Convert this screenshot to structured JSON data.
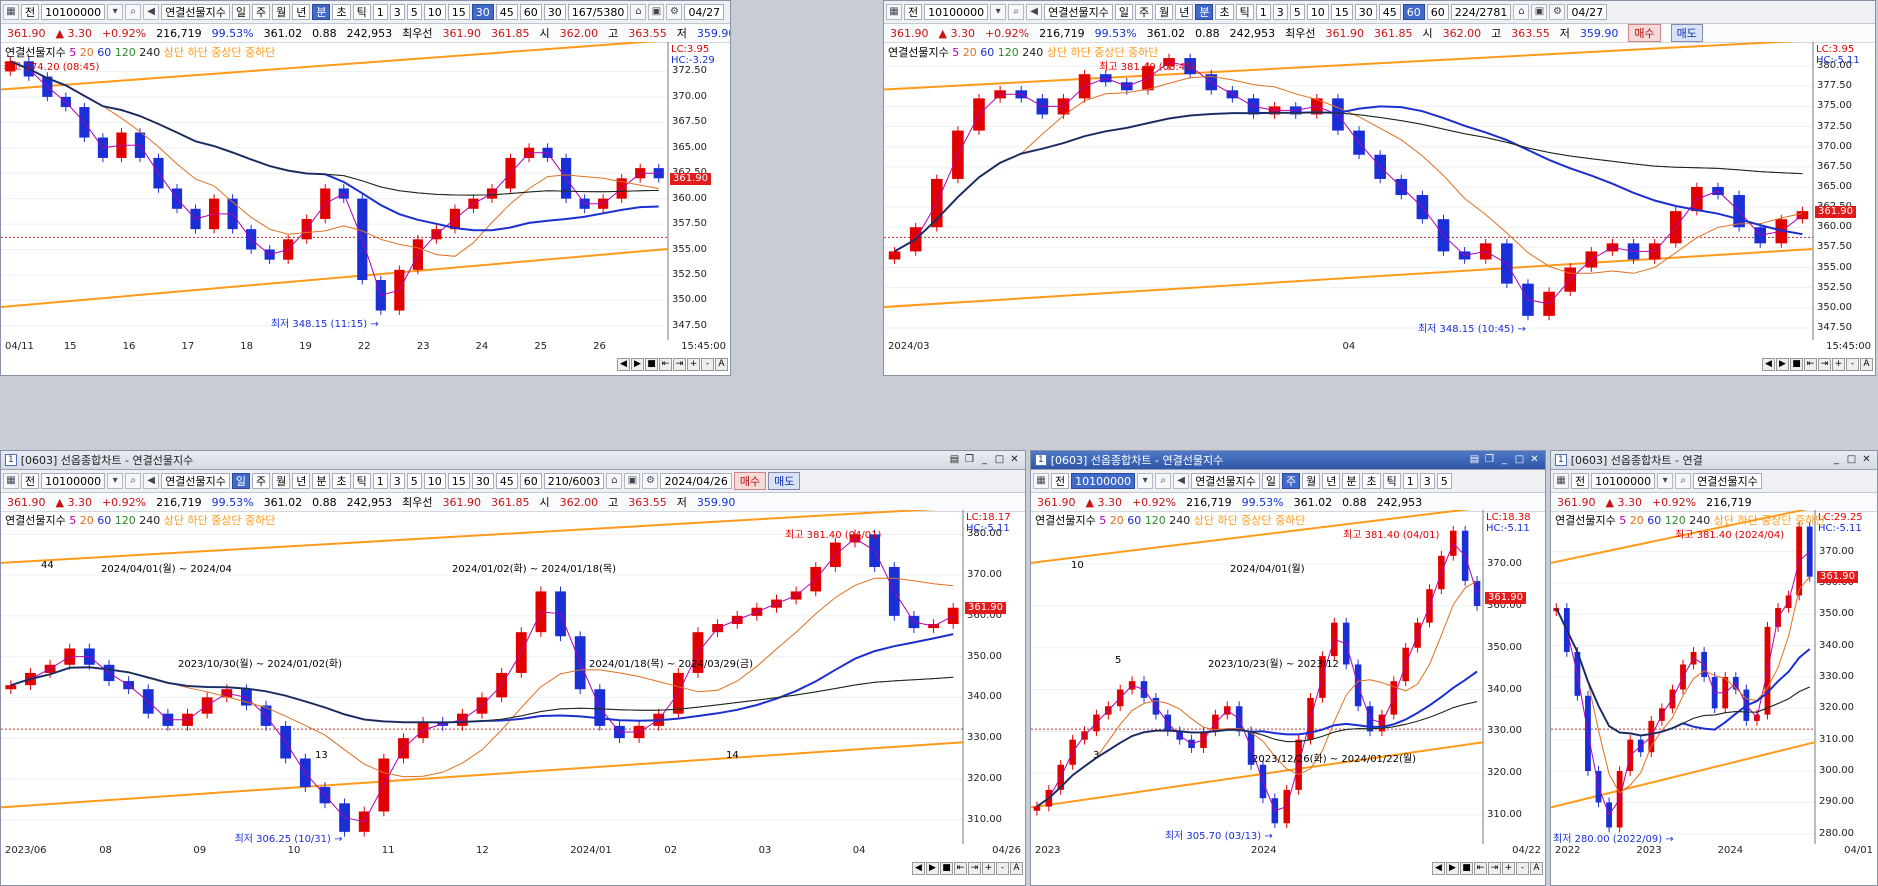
{
  "common": {
    "code": "10100000",
    "index_name": "연결선물지수",
    "periods": [
      "일",
      "주",
      "월",
      "년",
      "분",
      "초",
      "틱"
    ],
    "minutes": [
      "1",
      "3",
      "5",
      "10",
      "15",
      "30",
      "45",
      "60"
    ],
    "quote": {
      "price": "361.90",
      "arrow": "▲",
      "change": "3.30",
      "pct": "+0.92%",
      "volume": "216,719",
      "ratio": "99.53%",
      "v1": "361.02",
      "v2": "0.88",
      "oi": "242,953",
      "best_label": "최우선",
      "bid": "361.90",
      "ask": "361.85",
      "open_label": "시",
      "open": "362.00",
      "high_label": "고",
      "high": "363.55",
      "low_label": "저",
      "low": "359.90"
    },
    "buy_label": "매수",
    "sell_label": "매도",
    "legend_name": "연결선물지수",
    "ma": [
      "5",
      "20",
      "60",
      "120",
      "240"
    ],
    "bands": "상단 하단 중상단 중하단",
    "colors": {
      "up": "#e00000",
      "down": "#1a2fd6",
      "ma5": "#b000b0",
      "ma20": "#e07020",
      "ma60": "#1b2fd0",
      "ma120": "#2a8a2a",
      "ma240": "#222222",
      "channel": "#ff9a1a",
      "trend": "#7fb0ec"
    }
  },
  "panels": [
    {
      "sel_period": "분",
      "sel_minute": "30",
      "period_input": "30",
      "count": "167/5380",
      "date": "04/27",
      "lc": "LC:3.95",
      "hc": "HC:-3.29",
      "tag": "361.90",
      "yaxis": [
        "372.50",
        "370.00",
        "367.50",
        "365.00",
        "362.50",
        "360.00",
        "357.50",
        "355.00",
        "352.50",
        "350.00",
        "347.50"
      ],
      "xaxis": [
        "04/11",
        "15",
        "16",
        "17",
        "18",
        "19",
        "22",
        "23",
        "24",
        "25",
        "26",
        "15:45:00"
      ],
      "high_ann": "최고 374.20 (08:45)",
      "low_ann": "최저 348.15 (11:15)",
      "chart_data": {
        "type": "line",
        "title": "연결선물지수",
        "x_unit": "30min",
        "ylim": [
          346.5,
          375
        ],
        "series": [
          {
            "name": "연결선물지수",
            "values": [
              373.5,
              372,
              370,
              369,
              366,
              364,
              366.5,
              364,
              361,
              359,
              357,
              360,
              357,
              355,
              354,
              356,
              358,
              361,
              360,
              352,
              349,
              353,
              356,
              357,
              359,
              360,
              361,
              364,
              365,
              364,
              360,
              359,
              360,
              362,
              363,
              362
            ]
          }
        ]
      }
    },
    {
      "sel_period": "분",
      "sel_minute": "60",
      "period_input": "60",
      "count": "224/2781",
      "date": "04/27",
      "lc": "LC:3.95",
      "hc": "HC:-5.11",
      "tag": "361.90",
      "yaxis": [
        "380.00",
        "377.50",
        "375.00",
        "372.50",
        "370.00",
        "367.50",
        "365.00",
        "362.50",
        "360.00",
        "357.50",
        "355.00",
        "352.50",
        "350.00",
        "347.50"
      ],
      "xaxis": [
        "2024/03",
        "04",
        "15:45:00"
      ],
      "high_ann": "최고 381.40 (08:45)",
      "low_ann": "최저 348.15 (10:45)",
      "chart_data": {
        "type": "line",
        "title": "연결선물지수",
        "x_unit": "60min",
        "ylim": [
          346.5,
          382.5
        ],
        "series": [
          {
            "name": "연결선물지수",
            "values": [
              357,
              360,
              366,
              372,
              376,
              377,
              376,
              374,
              376,
              379,
              378,
              377,
              380,
              381,
              379,
              377,
              376,
              374,
              375,
              374,
              376,
              372,
              369,
              366,
              364,
              361,
              357,
              356,
              358,
              353,
              349,
              352,
              355,
              357,
              358,
              356,
              358,
              362,
              365,
              364,
              360,
              358,
              361,
              362
            ]
          }
        ]
      }
    },
    {
      "title": "[0603] 선옵종합차트 - 연결선물지수",
      "titlenum": "1",
      "sel_period": "일",
      "count": "210/6003",
      "date": "2024/04/26",
      "lc": "LC:18.17",
      "hc": "HC:-5.11",
      "tag": "361.90",
      "yaxis": [
        "380.00",
        "370.00",
        "360.00",
        "350.00",
        "340.00",
        "330.00",
        "320.00",
        "310.00"
      ],
      "xaxis": [
        "2023/06",
        "08",
        "09",
        "10",
        "11",
        "12",
        "2024/01",
        "02",
        "03",
        "04",
        "04/26"
      ],
      "anns": [
        "44",
        "2023/10/30(월) ~ 2024/01/02(화)",
        "13",
        "2024/01/02(화) ~ 2024/01/18(목)",
        "2024/01/18(목) ~ 2024/03/29(금)",
        "14",
        "2024/04/01(월) ~ 2024/04"
      ],
      "high_ann": "최고 381.40 (04/01)",
      "low_ann": "최저 306.25 (10/31)",
      "chart_data": {
        "type": "line",
        "title": "연결선물지수",
        "x_unit": "day",
        "ylim": [
          305,
          385
        ],
        "series": [
          {
            "name": "연결선물지수",
            "values": [
              343,
              346,
              348,
              352,
              348,
              344,
              342,
              336,
              333,
              336,
              340,
              342,
              338,
              333,
              325,
              318,
              314,
              307,
              312,
              325,
              330,
              334,
              333,
              336,
              340,
              346,
              356,
              366,
              355,
              342,
              333,
              330,
              333,
              336,
              346,
              356,
              358,
              360,
              362,
              364,
              366,
              372,
              378,
              380,
              372,
              360,
              357,
              358,
              362
            ]
          }
        ]
      }
    },
    {
      "title": "[0603] 선옵종합차트 - 연결선물지수",
      "titlenum": "1",
      "sel_period": "주",
      "date": "04/22",
      "lc": "LC:18.38",
      "hc": "HC:-5.11",
      "tag": "361.90",
      "yaxis": [
        "370.00",
        "360.00",
        "350.00",
        "340.00",
        "330.00",
        "320.00",
        "310.00"
      ],
      "xaxis": [
        "2023",
        "2024",
        "04/22"
      ],
      "anns": [
        "10",
        "2023/10/23(월) ~ 2023/12",
        "3",
        "2024/04/01(월)",
        "5",
        "2023/12/26(화) ~ 2024/01/22(월)"
      ],
      "high_ann": "최고 381.40 (04/01)",
      "low_ann": "최저 305.70 (03/13)",
      "chart_data": {
        "type": "line",
        "title": "연결선물지수",
        "x_unit": "week",
        "ylim": [
          304,
          382
        ],
        "series": [
          {
            "name": "연결선물지수",
            "values": [
              312,
              316,
              322,
              328,
              330,
              334,
              336,
              340,
              342,
              338,
              334,
              330,
              328,
              326,
              330,
              334,
              336,
              330,
              322,
              314,
              308,
              316,
              328,
              338,
              348,
              356,
              346,
              336,
              330,
              334,
              342,
              350,
              356,
              364,
              372,
              378,
              366,
              360
            ]
          }
        ]
      }
    },
    {
      "title": "[0603] 선옵종합차트 - 연결",
      "titlenum": "1",
      "sel_period": "월",
      "lc": "LC:29.25",
      "hc": "HC:-5.11",
      "tag": "361.90",
      "yaxis": [
        "370.00",
        "360.00",
        "350.00",
        "340.00",
        "330.00",
        "320.00",
        "310.00",
        "300.00",
        "290.00",
        "280.00"
      ],
      "xaxis": [
        "2022",
        "2023",
        "2024",
        "04/01"
      ],
      "high_ann": "최고 381.40 (2024/04)",
      "low_ann": "최저 280.00 (2022/09)",
      "chart_data": {
        "type": "line",
        "title": "연결선물지수",
        "x_unit": "month",
        "ylim": [
          278,
          382
        ],
        "series": [
          {
            "name": "연결선물지수",
            "values": [
              352,
              338,
              324,
              300,
              290,
              282,
              300,
              310,
              306,
              316,
              320,
              326,
              334,
              338,
              330,
              320,
              330,
              326,
              316,
              318,
              346,
              352,
              356,
              378,
              362
            ]
          }
        ]
      }
    }
  ]
}
